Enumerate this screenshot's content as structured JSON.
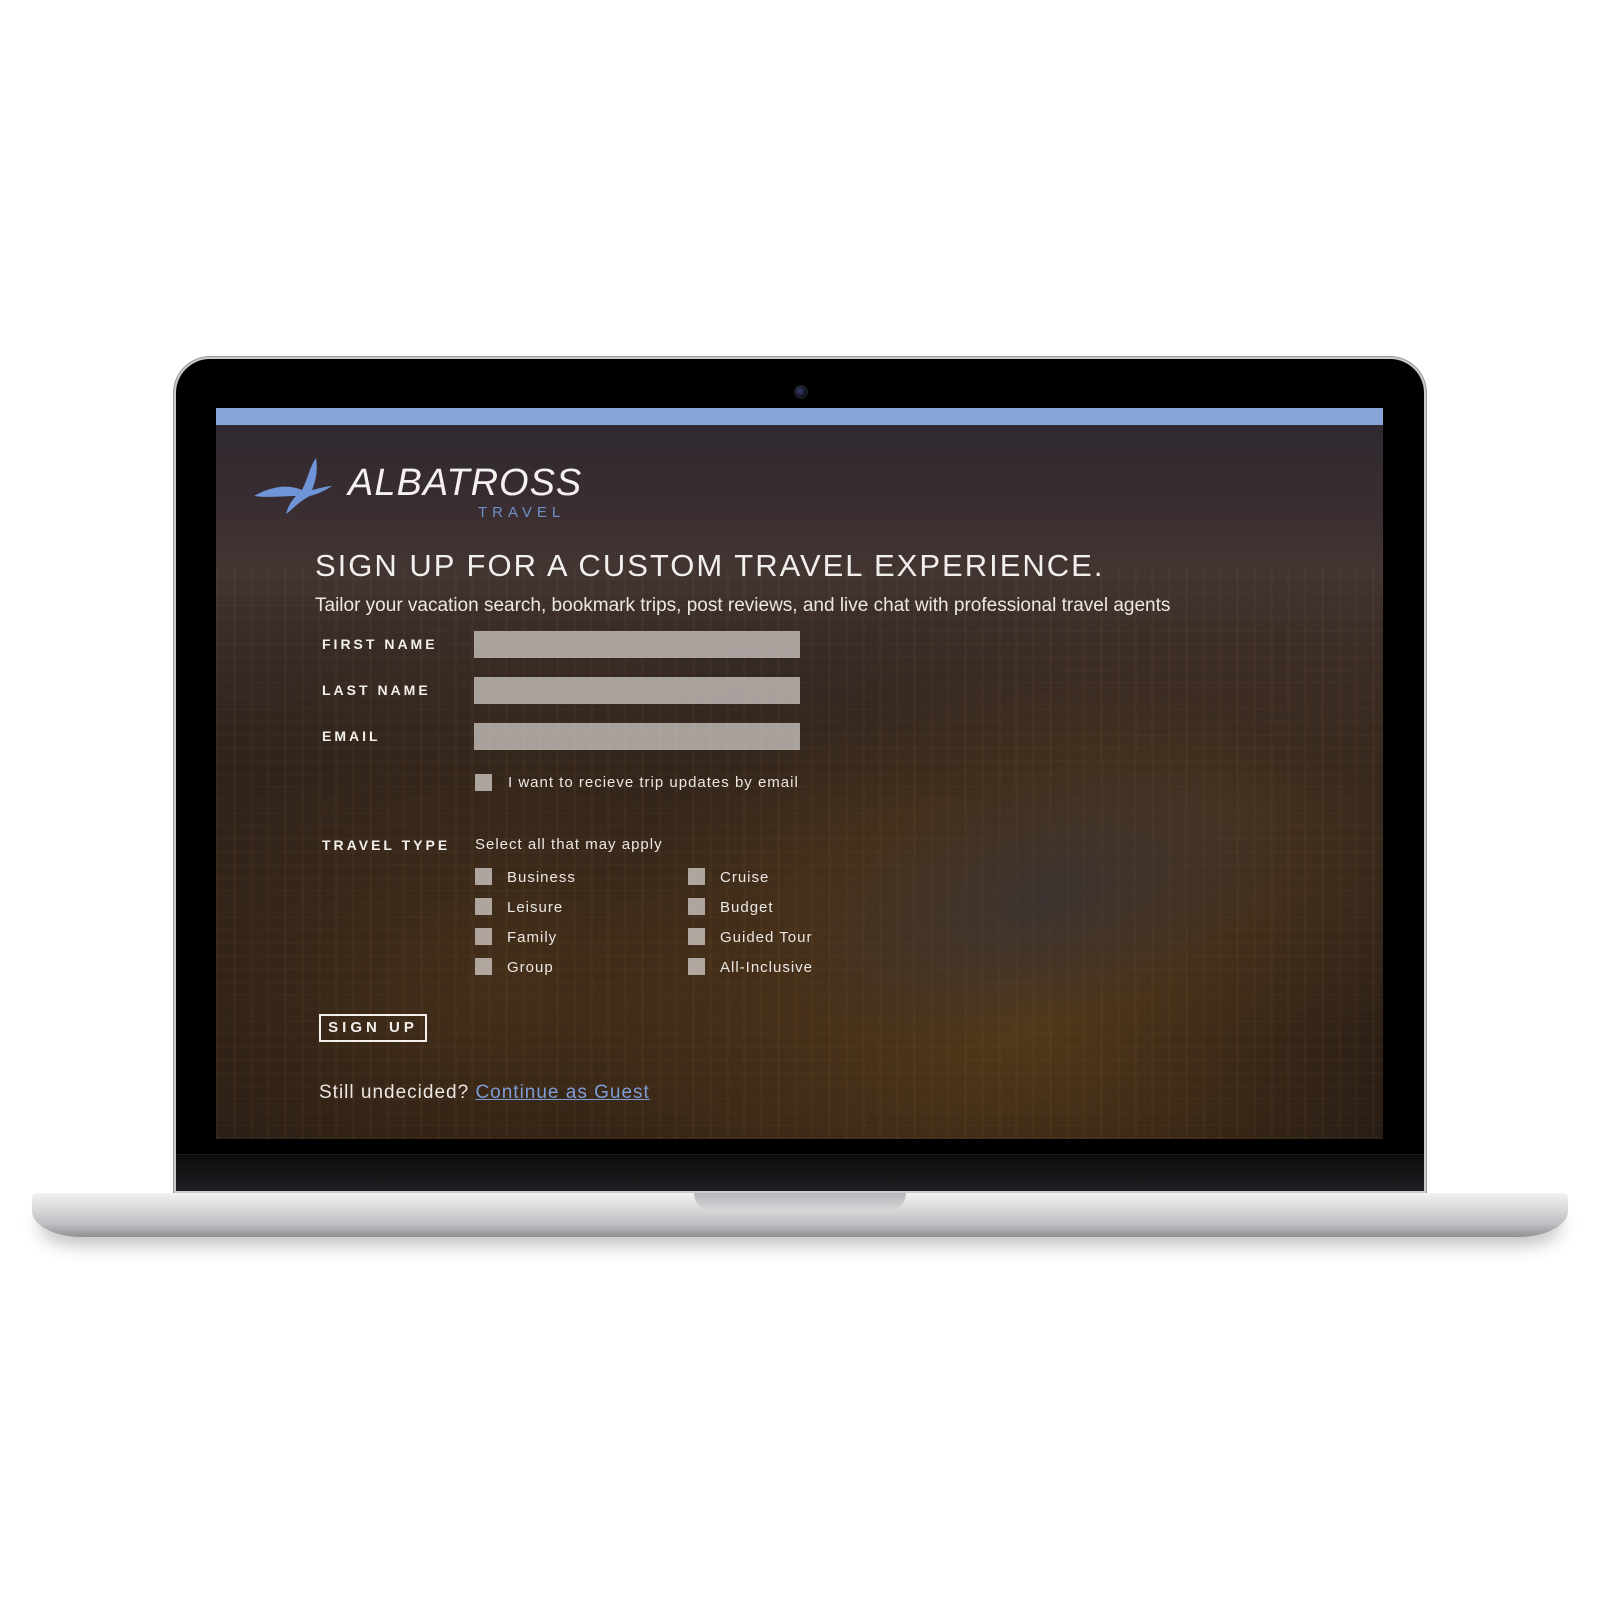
{
  "brand": {
    "name": "ALBATROSS",
    "sub": "TRAVEL",
    "accent": "#86a5d9",
    "logo_icon": "albatross-bird-icon"
  },
  "page": {
    "headline": "SIGN UP FOR A CUSTOM TRAVEL EXPERIENCE.",
    "subline": "Tailor your vacation search, bookmark trips, post reviews, and live chat with professional travel agents"
  },
  "form": {
    "first_name_label": "FIRST NAME",
    "last_name_label": "LAST NAME",
    "email_label": "EMAIL",
    "first_name_value": "",
    "last_name_value": "",
    "email_value": "",
    "updates_label": "I want to recieve trip updates by email",
    "travel_type_label": "TRAVEL TYPE",
    "travel_type_hint": "Select all that may apply",
    "options_left": [
      "Business",
      "Leisure",
      "Family",
      "Group"
    ],
    "options_right": [
      "Cruise",
      "Budget",
      "Guided Tour",
      "All-Inclusive"
    ],
    "signup_label": "SIGN UP"
  },
  "footer": {
    "prompt": "Still undecided?",
    "guest_link": "Continue as Guest",
    "link_color": "#7e9ed8"
  }
}
